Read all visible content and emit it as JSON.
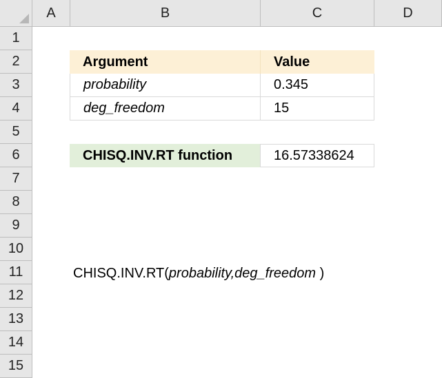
{
  "columns": [
    "A",
    "B",
    "C",
    "D"
  ],
  "rows": [
    "1",
    "2",
    "3",
    "4",
    "5",
    "6",
    "7",
    "8",
    "9",
    "10",
    "11",
    "12",
    "13",
    "14",
    "15"
  ],
  "table": {
    "header": {
      "argument": "Argument",
      "value": "Value"
    },
    "rows": [
      {
        "argument": "probability",
        "value": "0.345"
      },
      {
        "argument": "deg_freedom",
        "value": "15"
      }
    ]
  },
  "function_row": {
    "label": "CHISQ.INV.RT function",
    "result": "16.57338624"
  },
  "syntax": {
    "prefix": "CHISQ.INV.RT(",
    "args": "probability,deg_freedom",
    "suffix": " )"
  },
  "colors": {
    "header_fill": "#fdf0d6",
    "function_fill": "#e2efda",
    "header_bg": "#e6e6e6",
    "gridline": "#d4d4d4"
  }
}
